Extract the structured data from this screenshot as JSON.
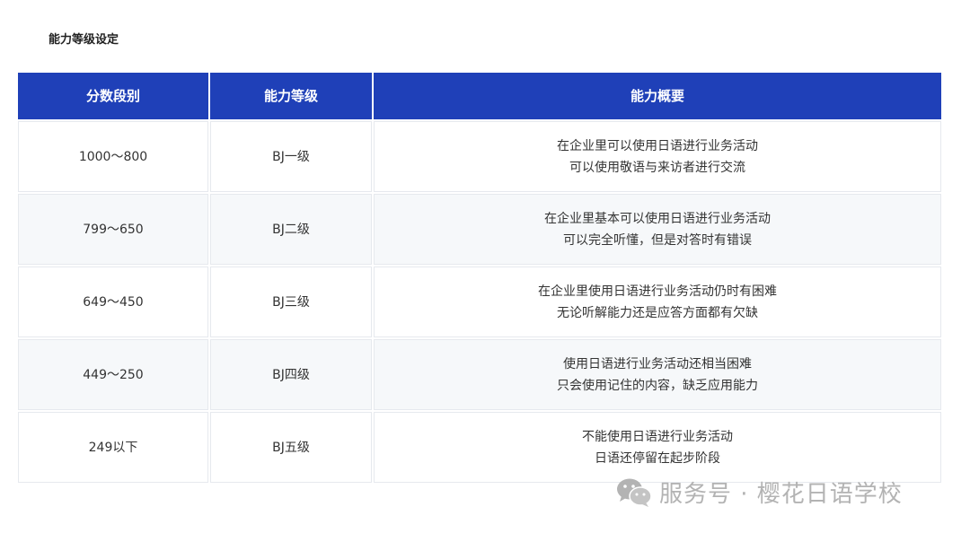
{
  "heading": "能力等级设定",
  "table": {
    "headers": [
      "分数段别",
      "能力等级",
      "能力概要"
    ],
    "rows": [
      {
        "score": "1000～800",
        "level": "BJ一级",
        "summary": [
          "在企业里可以使用日语进行业务活动",
          "可以使用敬语与来访者进行交流"
        ]
      },
      {
        "score": "799～650",
        "level": "BJ二级",
        "summary": [
          "在企业里基本可以使用日语进行业务活动",
          "可以完全听懂，但是对答时有错误"
        ]
      },
      {
        "score": "649～450",
        "level": "BJ三级",
        "summary": [
          "在企业里使用日语进行业务活动仍时有困难",
          "无论听解能力还是应答方面都有欠缺"
        ]
      },
      {
        "score": "449～250",
        "level": "BJ四级",
        "summary": [
          "使用日语进行业务活动还相当困难",
          "只会使用记住的内容，缺乏应用能力"
        ]
      },
      {
        "score": "249以下",
        "level": "BJ五级",
        "summary": [
          "不能使用日语进行业务活动",
          "日语还停留在起步阶段"
        ]
      }
    ]
  },
  "watermark": {
    "icon": "wechat-icon",
    "text": "服务号 · 樱花日语学校"
  },
  "colors": {
    "header_bg": "#1f40b8",
    "header_text": "#ffffff",
    "alt_row_bg": "#f6f8fa",
    "watermark": "#b3b3b3"
  }
}
